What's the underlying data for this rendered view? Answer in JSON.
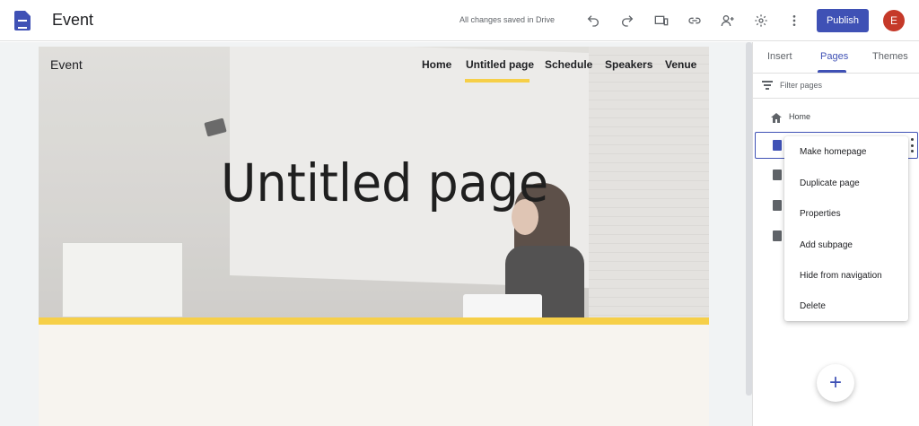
{
  "app": {
    "title": "Event",
    "save_status": "All changes saved in Drive",
    "publish_label": "Publish",
    "avatar_initial": "E"
  },
  "toolbar": {
    "icons": [
      "undo-icon",
      "redo-icon",
      "preview-icon",
      "link-icon",
      "share-icon",
      "settings-icon",
      "more-icon"
    ]
  },
  "site": {
    "name": "Event",
    "nav": [
      "Home",
      "Untitled page",
      "Schedule",
      "Speakers",
      "Venue"
    ],
    "active_nav": "Untitled page",
    "hero_title": "Untitled page",
    "accent_color": "#f6cf48"
  },
  "panel": {
    "tabs": [
      "Insert",
      "Pages",
      "Themes"
    ],
    "active_tab": "Pages",
    "filter_placeholder": "Filter pages",
    "pages": [
      "Home"
    ]
  },
  "context_menu": {
    "items": [
      "Make homepage",
      "Duplicate page",
      "Properties",
      "Add subpage",
      "Hide from navigation",
      "Delete"
    ]
  },
  "colors": {
    "primary": "#3f51b5",
    "avatar": "#c53929"
  }
}
